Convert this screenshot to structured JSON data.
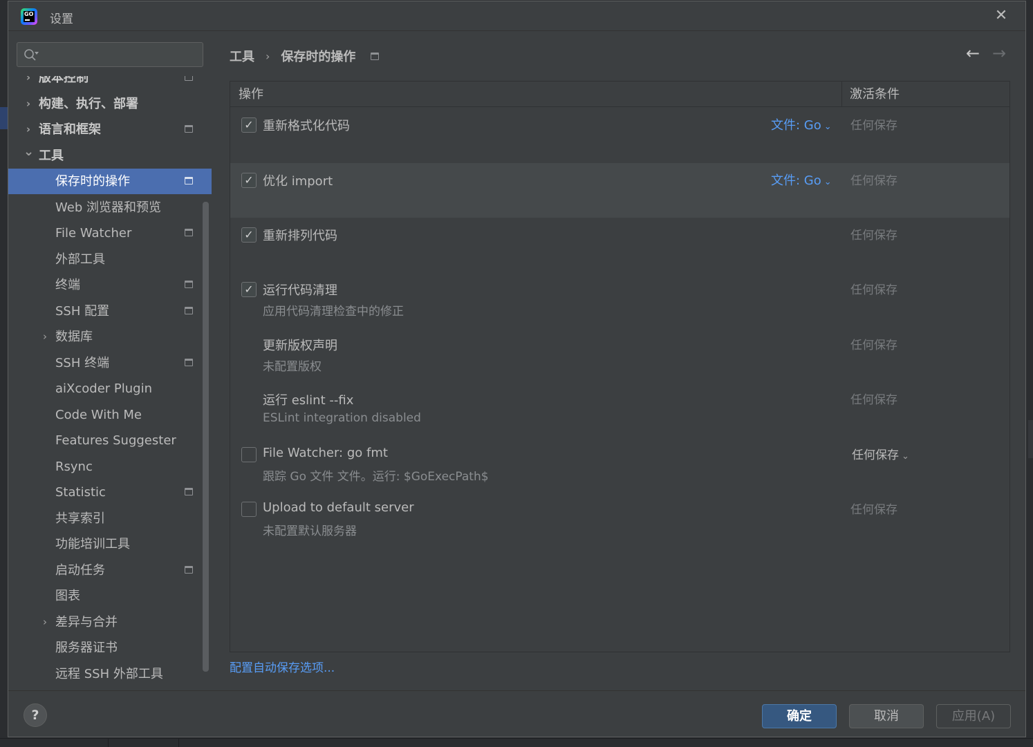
{
  "window": {
    "title": "设置",
    "app_logo_text": "GO"
  },
  "sidebar": {
    "search_placeholder": "",
    "items": [
      {
        "label": "版本控制",
        "level": 0,
        "expandable": true,
        "expanded": false,
        "project_icon": true
      },
      {
        "label": "构建、执行、部署",
        "level": 0,
        "expandable": true,
        "expanded": false,
        "project_icon": false
      },
      {
        "label": "语言和框架",
        "level": 0,
        "expandable": true,
        "expanded": false,
        "project_icon": true
      },
      {
        "label": "工具",
        "level": 0,
        "expandable": true,
        "expanded": true,
        "project_icon": false
      },
      {
        "label": "保存时的操作",
        "level": 1,
        "selected": true,
        "project_icon": true
      },
      {
        "label": "Web 浏览器和预览",
        "level": 1,
        "project_icon": false
      },
      {
        "label": "File Watcher",
        "level": 1,
        "project_icon": true
      },
      {
        "label": "外部工具",
        "level": 1,
        "project_icon": false
      },
      {
        "label": "终端",
        "level": 1,
        "project_icon": true
      },
      {
        "label": "SSH 配置",
        "level": 1,
        "project_icon": true
      },
      {
        "label": "数据库",
        "level": 1,
        "expandable": true,
        "expanded": false,
        "project_icon": false
      },
      {
        "label": "SSH 终端",
        "level": 1,
        "project_icon": true
      },
      {
        "label": "aiXcoder Plugin",
        "level": 1,
        "project_icon": false
      },
      {
        "label": "Code With Me",
        "level": 1,
        "project_icon": false
      },
      {
        "label": "Features Suggester",
        "level": 1,
        "project_icon": false
      },
      {
        "label": "Rsync",
        "level": 1,
        "project_icon": false
      },
      {
        "label": "Statistic",
        "level": 1,
        "project_icon": true
      },
      {
        "label": "共享索引",
        "level": 1,
        "project_icon": false
      },
      {
        "label": "功能培训工具",
        "level": 1,
        "project_icon": false
      },
      {
        "label": "启动任务",
        "level": 1,
        "project_icon": true
      },
      {
        "label": "图表",
        "level": 1,
        "project_icon": false
      },
      {
        "label": "差异与合并",
        "level": 1,
        "expandable": true,
        "expanded": false,
        "project_icon": false
      },
      {
        "label": "服务器证书",
        "level": 1,
        "project_icon": false
      },
      {
        "label": "远程 SSH 外部工具",
        "level": 1,
        "project_icon": false
      }
    ]
  },
  "breadcrumb": {
    "parent": "工具",
    "separator": "›",
    "current": "保存时的操作"
  },
  "nav": {
    "back": "←",
    "forward": "→"
  },
  "table": {
    "headers": {
      "action": "操作",
      "condition": "激活条件"
    },
    "rows": [
      {
        "title": "重新格式化代码",
        "subtitle": "",
        "has_checkbox": true,
        "checked": true,
        "filter": "文件: Go",
        "condition": "任何保存",
        "condition_dropdown": false
      },
      {
        "title": "优化 import",
        "subtitle": "",
        "has_checkbox": true,
        "checked": true,
        "filter": "文件: Go",
        "condition": "任何保存",
        "condition_dropdown": false
      },
      {
        "title": "重新排列代码",
        "subtitle": "",
        "has_checkbox": true,
        "checked": true,
        "filter": "",
        "condition": "任何保存",
        "condition_dropdown": false
      },
      {
        "title": "运行代码清理",
        "subtitle": "应用代码清理检查中的修正",
        "has_checkbox": true,
        "checked": true,
        "filter": "",
        "condition": "任何保存",
        "condition_dropdown": false
      },
      {
        "title": "更新版权声明",
        "subtitle": "未配置版权",
        "has_checkbox": false,
        "checked": false,
        "filter": "",
        "condition": "任何保存",
        "condition_dropdown": false
      },
      {
        "title": "运行 eslint --fix",
        "subtitle": "ESLint integration disabled",
        "has_checkbox": false,
        "checked": false,
        "filter": "",
        "condition": "任何保存",
        "condition_dropdown": false
      },
      {
        "title": "File Watcher: go fmt",
        "subtitle": "跟踪 Go 文件 文件。运行: $GoExecPath$",
        "has_checkbox": true,
        "checked": false,
        "filter": "",
        "condition": "任何保存",
        "condition_dropdown": true
      },
      {
        "title": "Upload to default server",
        "subtitle": "未配置默认服务器",
        "has_checkbox": true,
        "checked": false,
        "filter": "",
        "condition": "任何保存",
        "condition_dropdown": false
      }
    ]
  },
  "config_link": "配置自动保存选项...",
  "buttons": {
    "help": "?",
    "ok": "确定",
    "cancel": "取消",
    "apply": "应用(A)"
  },
  "colors": {
    "background": "#3c3f41",
    "selection": "#4b6eaf",
    "link": "#589df6",
    "primary_button": "#365880"
  }
}
